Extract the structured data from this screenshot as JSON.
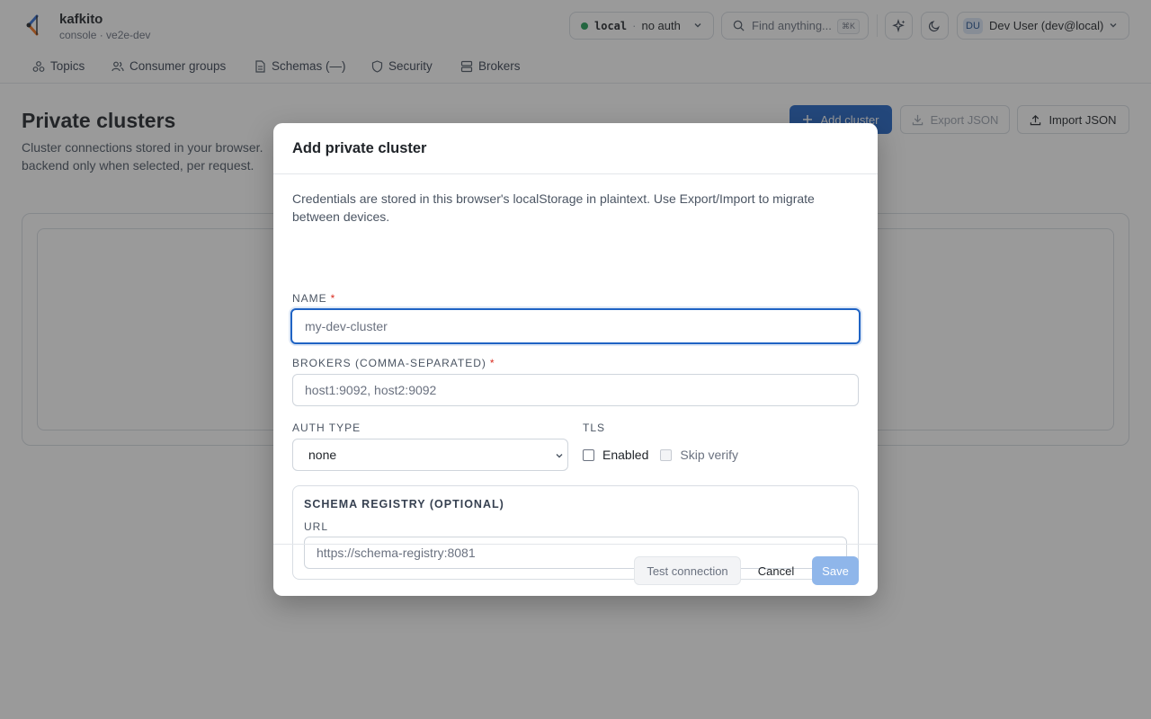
{
  "app": {
    "name": "kafkito",
    "subtitle": "console · ve2e-dev"
  },
  "header": {
    "cluster": {
      "name": "local",
      "auth": "no auth"
    },
    "search": {
      "placeholder": "Find anything...",
      "shortcut": "⌘K"
    },
    "user": {
      "initials": "DU",
      "label": "Dev User (dev@local)"
    }
  },
  "nav": [
    {
      "label": "Topics",
      "icon": "topics-icon"
    },
    {
      "label": "Consumer groups",
      "icon": "users-icon"
    },
    {
      "label": "Schemas (—)",
      "icon": "file-icon"
    },
    {
      "label": "Security",
      "icon": "shield-icon"
    },
    {
      "label": "Brokers",
      "icon": "server-icon"
    }
  ],
  "page": {
    "title": "Private clusters",
    "description_line1": "Cluster connections stored in your browser.",
    "description_line2": "backend only when selected, per request.",
    "add_cluster": "Add cluster",
    "export_json": "Export JSON",
    "import_json": "Import JSON"
  },
  "modal": {
    "title": "Add private cluster",
    "intro": "Credentials are stored in this browser's localStorage in plaintext. Use Export/Import to migrate between devices.",
    "name_label": "NAME",
    "name_placeholder": "my-dev-cluster",
    "brokers_label": "BROKERS (COMMA-SEPARATED)",
    "brokers_placeholder": "host1:9092, host2:9092",
    "auth_label": "AUTH TYPE",
    "auth_value": "none",
    "tls_label": "TLS",
    "tls_enabled_label": "Enabled",
    "tls_skip_label": "Skip verify",
    "schema_title": "SCHEMA REGISTRY (OPTIONAL)",
    "url_label": "URL",
    "url_placeholder": "https://schema-registry:8081",
    "required_mark": "*",
    "test_connection": "Test connection",
    "cancel": "Cancel",
    "save": "Save"
  },
  "colors": {
    "primary": "#1f63c4",
    "status_ok": "#1f9d55",
    "required": "#d92d20"
  }
}
